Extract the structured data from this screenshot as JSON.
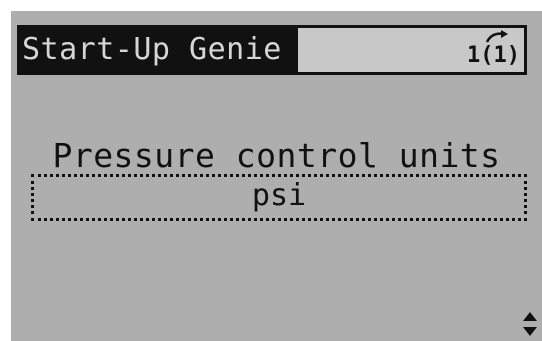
{
  "header": {
    "title": "Start-Up Genie",
    "page_indicator": "1(1)"
  },
  "main": {
    "parameter_label": "Pressure control units",
    "parameter_value": "psi"
  },
  "icons": {
    "page_arrow": "curved-arrow-icon",
    "scroll": "up-down-arrows-icon"
  },
  "colors": {
    "lcd_background": "#aeaeae",
    "text": "#111111"
  }
}
